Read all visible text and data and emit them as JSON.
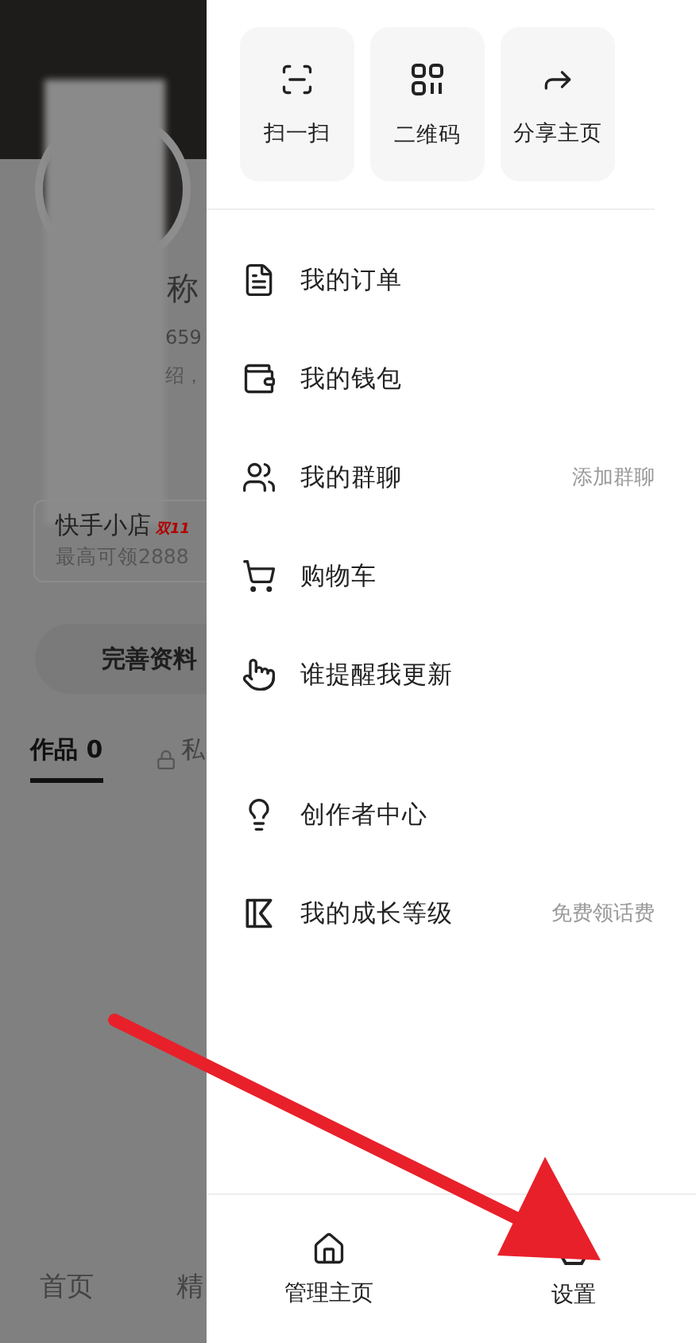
{
  "background_profile": {
    "name_fragment": "称",
    "id_fragment": "659",
    "bio_fragment": "绍，",
    "shop": {
      "title": "快手小店",
      "badge": "双11",
      "subtitle": "最高可领2888"
    },
    "edit_button": "完善资料",
    "tabs": [
      {
        "label": "作品 0",
        "selected": true,
        "locked": false
      },
      {
        "label": "私",
        "selected": false,
        "locked": true
      }
    ],
    "bottom_nav": [
      "首页",
      "精"
    ]
  },
  "quick_actions": [
    {
      "kind": "scan",
      "label": "扫一扫"
    },
    {
      "kind": "qr",
      "label": "二维码"
    },
    {
      "kind": "share",
      "label": "分享主页"
    }
  ],
  "menu_groups": [
    [
      {
        "kind": "orders",
        "label": "我的订单"
      },
      {
        "kind": "wallet",
        "label": "我的钱包"
      },
      {
        "kind": "groups",
        "label": "我的群聊",
        "extra": "添加群聊"
      },
      {
        "kind": "cart",
        "label": "购物车"
      },
      {
        "kind": "remind",
        "label": "谁提醒我更新"
      }
    ],
    [
      {
        "kind": "creator",
        "label": "创作者中心"
      },
      {
        "kind": "level",
        "label": "我的成长等级",
        "extra": "免费领话费"
      }
    ]
  ],
  "drawer_footer": [
    {
      "kind": "home",
      "label": "管理主页"
    },
    {
      "kind": "settings",
      "label": "设置"
    }
  ]
}
